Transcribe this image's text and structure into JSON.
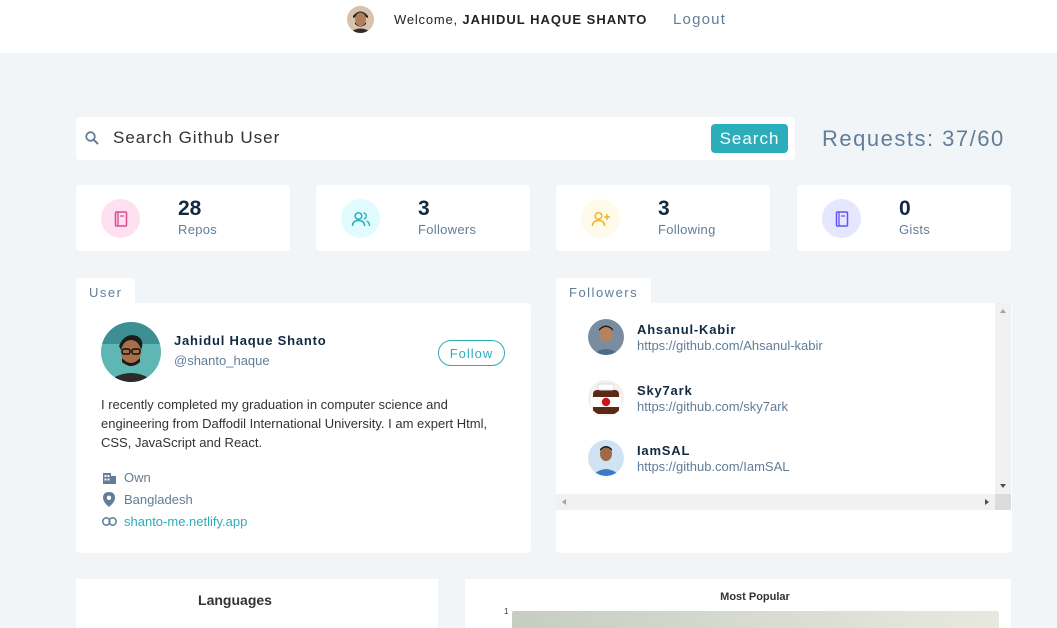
{
  "navbar": {
    "welcome_prefix": "Welcome,",
    "user_name": "JAHIDUL HAQUE SHANTO",
    "logout_label": "Logout"
  },
  "search": {
    "placeholder": "Search Github User",
    "button_label": "Search",
    "requests_text": "Requests: 37/60"
  },
  "stats": [
    {
      "value": "28",
      "label": "Repos",
      "icon": "book-icon",
      "color": "#da4a91",
      "bg": "#ffe0f0"
    },
    {
      "value": "3",
      "label": "Followers",
      "icon": "users-icon",
      "color": "#2caeba",
      "bg": "#e0fcff"
    },
    {
      "value": "3",
      "label": "Following",
      "icon": "user-plus-icon",
      "color": "#f0b429",
      "bg": "#fffbea"
    },
    {
      "value": "0",
      "label": "Gists",
      "icon": "book-icon",
      "color": "#5d55fa",
      "bg": "#e6e6ff"
    }
  ],
  "user_card": {
    "tab_label": "User",
    "name": "Jahidul Haque Shanto",
    "handle": "@shanto_haque",
    "follow_label": "Follow",
    "bio": "I recently completed my graduation in computer science and engineering from Daffodil International University. I am expert Html, CSS, JavaScript and React.",
    "company": "Own",
    "location": "Bangladesh",
    "blog": "shanto-me.netlify.app"
  },
  "followers_card": {
    "tab_label": "Followers",
    "items": [
      {
        "login": "Ahsanul-Kabir",
        "url": "https://github.com/Ahsanul-kabir"
      },
      {
        "login": "Sky7ark",
        "url": "https://github.com/sky7ark"
      },
      {
        "login": "IamSAL",
        "url": "https://github.com/IamSAL"
      }
    ]
  },
  "charts": {
    "languages_title": "Languages",
    "popular_title": "Most Popular",
    "popular_axis_tick": "1"
  },
  "colors": {
    "accent": "#2caeba",
    "background": "#f1f5f8",
    "muted_text": "#617d98",
    "dark_text": "#102a42"
  }
}
